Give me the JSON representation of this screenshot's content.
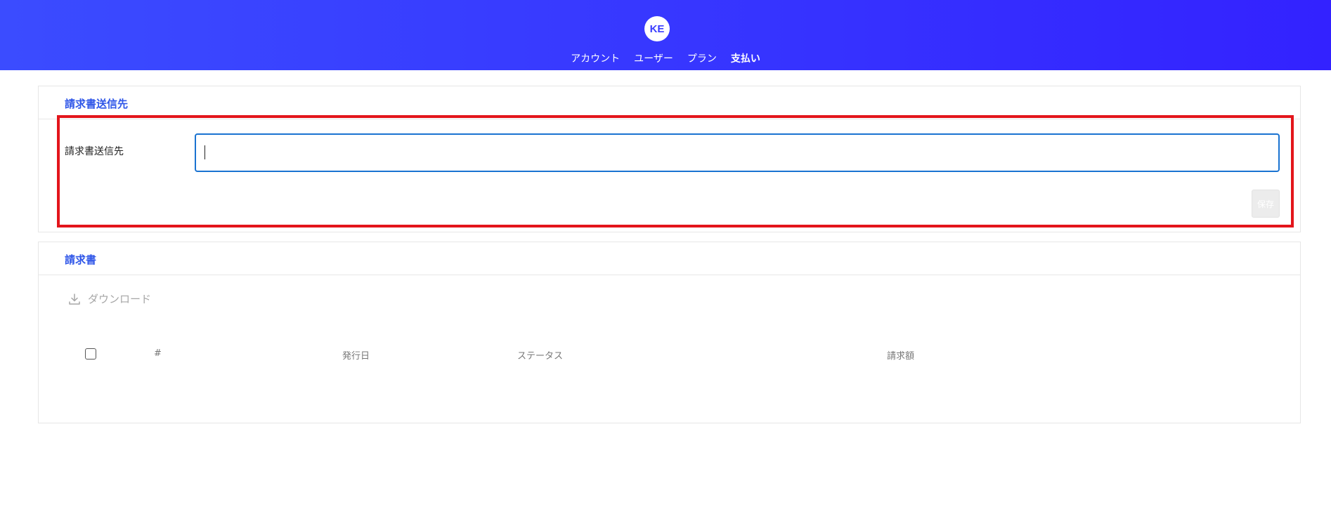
{
  "header": {
    "avatar_initials": "KE",
    "nav": [
      {
        "label": "アカウント",
        "active": false
      },
      {
        "label": "ユーザー",
        "active": false
      },
      {
        "label": "プラン",
        "active": false
      },
      {
        "label": "支払い",
        "active": true
      }
    ]
  },
  "billing_recipient": {
    "title": "請求書送信先",
    "field_label": "請求書送信先",
    "input_value": "",
    "input_placeholder": "",
    "save_label": "保存"
  },
  "invoices": {
    "title": "請求書",
    "download_label": "ダウンロード",
    "download_icon": "download-icon",
    "columns": [
      "#",
      "発行日",
      "ステータス",
      "請求額"
    ],
    "rows": []
  },
  "colors": {
    "header_gradient_start": "#3b4cff",
    "header_gradient_end": "#3322ff",
    "accent": "#2f56e8",
    "input_focus": "#1a73d1",
    "highlight": "#e3151b"
  }
}
